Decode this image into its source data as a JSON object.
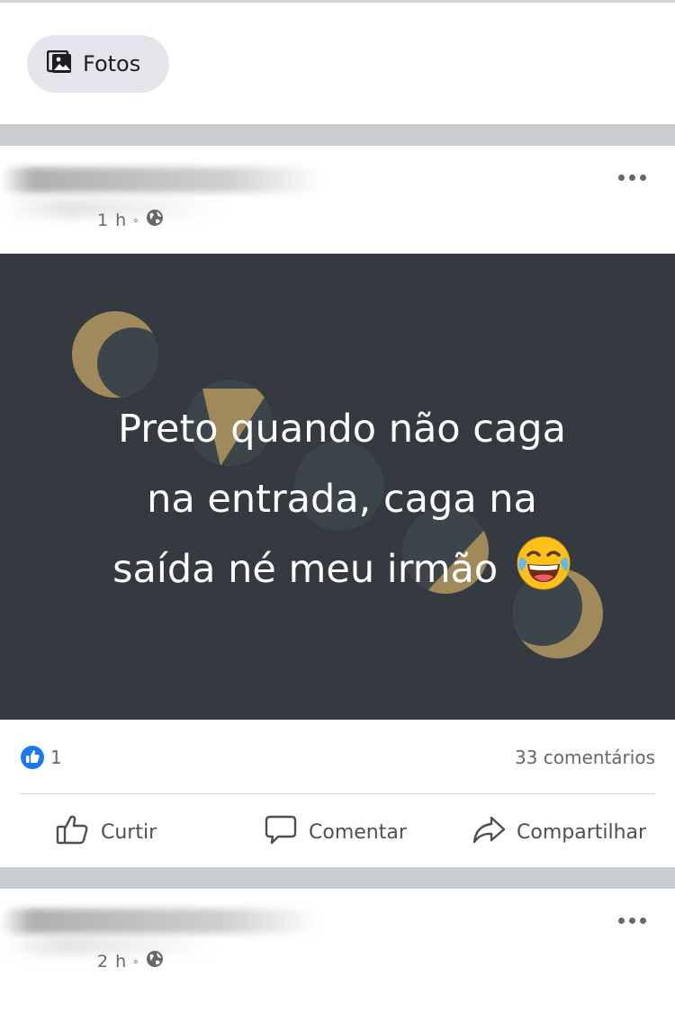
{
  "chip": {
    "icon": "photo-icon",
    "label": "Fotos"
  },
  "posts": [
    {
      "time": "1 h",
      "privacy_icon": "globe-icon",
      "more_icon": "more-dots-icon"
    },
    {
      "time": "2 h",
      "privacy_icon": "globe-icon",
      "more_icon": "more-dots-icon"
    }
  ],
  "post_image": {
    "lines": [
      "Preto quando não caga",
      "na entrada, caga na",
      "saída né meu irmão"
    ],
    "emoji": "tears-of-joy-emoji",
    "background_color": "#343a40",
    "accent_color": "#a08a5b"
  },
  "reactions": {
    "like_count": "1",
    "comments": "33 comentários",
    "like_color": "#1877f2"
  },
  "actions": {
    "like_label": "Curtir",
    "comment_label": "Comentar",
    "share_label": "Compartilhar"
  }
}
